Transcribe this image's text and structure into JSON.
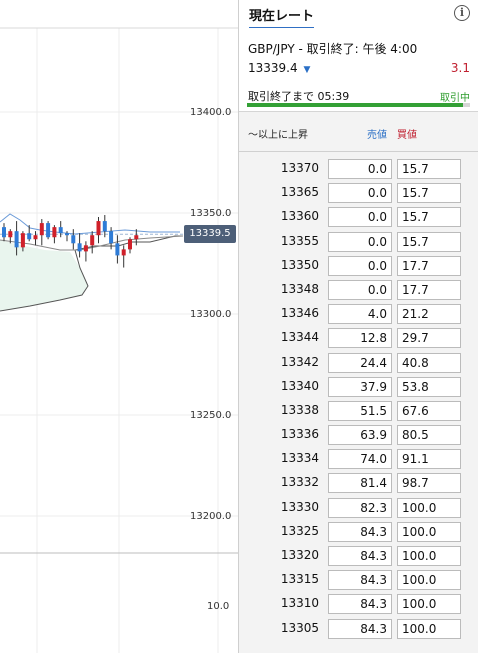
{
  "chart": {
    "y_ticks": [
      "13400.0",
      "13350.0",
      "13300.0",
      "13250.0",
      "13200.0"
    ],
    "indicator_tick": "10.0",
    "current_price_label": "13339.5",
    "ohlc_candles": [
      [
        13343,
        13345,
        13336,
        13338
      ],
      [
        13338,
        13342,
        13335,
        13341
      ],
      [
        13341,
        13346,
        13329,
        13333
      ],
      [
        13333,
        13341,
        13331,
        13340
      ],
      [
        13340,
        13344,
        13336,
        13337
      ],
      [
        13337,
        13341,
        13334,
        13339
      ],
      [
        13339,
        13347,
        13334,
        13345
      ],
      [
        13345,
        13346,
        13337,
        13338
      ],
      [
        13338,
        13344,
        13335,
        13343
      ],
      [
        13343,
        13346,
        13338,
        13340
      ],
      [
        13340,
        13341,
        13336,
        13339
      ],
      [
        13339,
        13342,
        13332,
        13335
      ],
      [
        13335,
        13340,
        13328,
        13331
      ],
      [
        13331,
        13336,
        13326,
        13334
      ],
      [
        13334,
        13341,
        13330,
        13339
      ],
      [
        13339,
        13348,
        13335,
        13346
      ],
      [
        13346,
        13349,
        13338,
        13341
      ],
      [
        13341,
        13343,
        13332,
        13335
      ],
      [
        13335,
        13339,
        13325,
        13329
      ],
      [
        13329,
        13334,
        13323,
        13332
      ],
      [
        13332,
        13338,
        13330,
        13337
      ],
      [
        13337,
        13342,
        13334,
        13339
      ]
    ],
    "colors": {
      "up": "#d0202a",
      "down": "#2e7bd6",
      "cloud": "#e9f5ee",
      "line": "#555555"
    }
  },
  "panel": {
    "tab_label": "現在レート",
    "info_icon": "i",
    "pair_line": "GBP/JPY - 取引終了: 午後 4:00",
    "rate": "13339.4",
    "rate_arrow": "▼",
    "spread": "3.1",
    "countdown": "取引終了まで 05:39",
    "status": "取引中",
    "progress_fraction": 0.97,
    "col_strike": "〜以上に上昇",
    "col_bid": "売値",
    "col_ask": "買値",
    "rows": [
      {
        "strike": "13370",
        "bid": "0.0",
        "ask": "15.7"
      },
      {
        "strike": "13365",
        "bid": "0.0",
        "ask": "15.7"
      },
      {
        "strike": "13360",
        "bid": "0.0",
        "ask": "15.7"
      },
      {
        "strike": "13355",
        "bid": "0.0",
        "ask": "15.7"
      },
      {
        "strike": "13350",
        "bid": "0.0",
        "ask": "17.7"
      },
      {
        "strike": "13348",
        "bid": "0.0",
        "ask": "17.7"
      },
      {
        "strike": "13346",
        "bid": "4.0",
        "ask": "21.2"
      },
      {
        "strike": "13344",
        "bid": "12.8",
        "ask": "29.7"
      },
      {
        "strike": "13342",
        "bid": "24.4",
        "ask": "40.8"
      },
      {
        "strike": "13340",
        "bid": "37.9",
        "ask": "53.8"
      },
      {
        "strike": "13338",
        "bid": "51.5",
        "ask": "67.6"
      },
      {
        "strike": "13336",
        "bid": "63.9",
        "ask": "80.5"
      },
      {
        "strike": "13334",
        "bid": "74.0",
        "ask": "91.1"
      },
      {
        "strike": "13332",
        "bid": "81.4",
        "ask": "98.7"
      },
      {
        "strike": "13330",
        "bid": "82.3",
        "ask": "100.0"
      },
      {
        "strike": "13325",
        "bid": "84.3",
        "ask": "100.0"
      },
      {
        "strike": "13320",
        "bid": "84.3",
        "ask": "100.0"
      },
      {
        "strike": "13315",
        "bid": "84.3",
        "ask": "100.0"
      },
      {
        "strike": "13310",
        "bid": "84.3",
        "ask": "100.0"
      },
      {
        "strike": "13305",
        "bid": "84.3",
        "ask": "100.0"
      }
    ]
  }
}
